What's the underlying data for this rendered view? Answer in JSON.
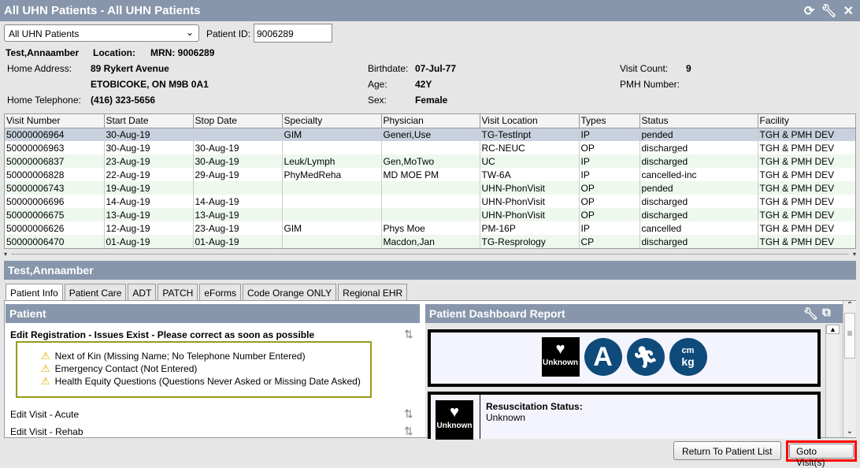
{
  "window": {
    "title": "All UHN Patients - All UHN Patients",
    "icons": [
      "refresh-icon",
      "wrench-icon",
      "close-icon"
    ]
  },
  "filter": {
    "list_value": "All UHN Patients",
    "patient_id_label": "Patient ID:",
    "patient_id_value": "9006289"
  },
  "patient": {
    "name": "Test,Annaamber",
    "location_label": "Location:",
    "mrn": "MRN: 9006289",
    "home_address_label": "Home Address:",
    "address_line1": "89 Rykert Avenue",
    "address_line2": "ETOBICOKE, ON  M9B 0A1",
    "home_telephone_label": "Home Telephone:",
    "telephone": "(416) 323-5656",
    "birthdate_label": "Birthdate:",
    "birthdate": "07-Jul-77",
    "age_label": "Age:",
    "age": "42Y",
    "sex_label": "Sex:",
    "sex": "Female",
    "visit_count_label": "Visit Count:",
    "visit_count": "9",
    "pmh_label": "PMH Number:"
  },
  "visits": {
    "columns": [
      "Visit Number",
      "Start Date",
      "Stop Date",
      "Specialty",
      "Physician",
      "Visit Location",
      "Types",
      "Status",
      "Facility"
    ],
    "rows": [
      [
        "50000006964",
        "30-Aug-19",
        "",
        "GIM",
        "Generi,Use",
        "TG-TestInpt",
        "IP",
        "pended",
        "TGH & PMH DEV"
      ],
      [
        "50000006963",
        "30-Aug-19",
        "30-Aug-19",
        "",
        "",
        "RC-NEUC",
        "OP",
        "discharged",
        "TGH & PMH DEV"
      ],
      [
        "50000006837",
        "23-Aug-19",
        "30-Aug-19",
        "Leuk/Lymph",
        "Gen,MoTwo",
        "UC",
        "IP",
        "discharged",
        "TGH & PMH DEV"
      ],
      [
        "50000006828",
        "22-Aug-19",
        "29-Aug-19",
        "PhyMedReha",
        "MD MOE PM",
        "TW-6A",
        "IP",
        "cancelled-inc",
        "TGH & PMH DEV"
      ],
      [
        "50000006743",
        "19-Aug-19",
        "",
        "",
        "",
        "UHN-PhonVisit",
        "OP",
        "pended",
        "TGH & PMH DEV"
      ],
      [
        "50000006696",
        "14-Aug-19",
        "14-Aug-19",
        "",
        "",
        "UHN-PhonVisit",
        "OP",
        "discharged",
        "TGH & PMH DEV"
      ],
      [
        "50000006675",
        "13-Aug-19",
        "13-Aug-19",
        "",
        "",
        "UHN-PhonVisit",
        "OP",
        "discharged",
        "TGH & PMH DEV"
      ],
      [
        "50000006626",
        "12-Aug-19",
        "23-Aug-19",
        "GIM",
        "Phys Moe",
        "PM-16P",
        "IP",
        "cancelled",
        "TGH & PMH DEV"
      ],
      [
        "50000006470",
        "01-Aug-19",
        "01-Aug-19",
        "",
        "Macdon,Jan",
        "TG-Resprology",
        "CP",
        "discharged",
        "TGH & PMH DEV"
      ]
    ]
  },
  "section_title": "Test,Annaamber",
  "tabs": [
    "Patient Info",
    "Patient Care",
    "ADT",
    "PATCH",
    "eForms",
    "Code Orange ONLY",
    "Regional EHR"
  ],
  "left_panel": {
    "title": "Patient",
    "edit_registration": "Edit Registration - Issues Exist - Please correct as soon as possible",
    "warnings": [
      "Next of Kin (Missing Name; No Telephone Number Entered)",
      "Emergency Contact (Not Entered)",
      "Health Equity Questions (Questions Never Asked or Missing Date Asked)"
    ],
    "edit_visit_acute": "Edit Visit - Acute",
    "edit_visit_rehab": "Edit Visit - Rehab"
  },
  "right_panel": {
    "title": "Patient Dashboard Report",
    "icon_unknown_label": "Unknown",
    "icon_a": "A",
    "icon_cm": "cm",
    "icon_kg": "kg",
    "resus_label": "Resuscitation Status:",
    "resus_value": "Unknown"
  },
  "buttons": {
    "return": "Return To Patient List",
    "goto": "Goto Visit(s)"
  },
  "colors": {
    "header": "#8796ab",
    "selected_row": "#c9d1de",
    "alt_row": "#eef8ee",
    "icon_blue": "#0e4a7a",
    "highlight": "#ff0000"
  }
}
